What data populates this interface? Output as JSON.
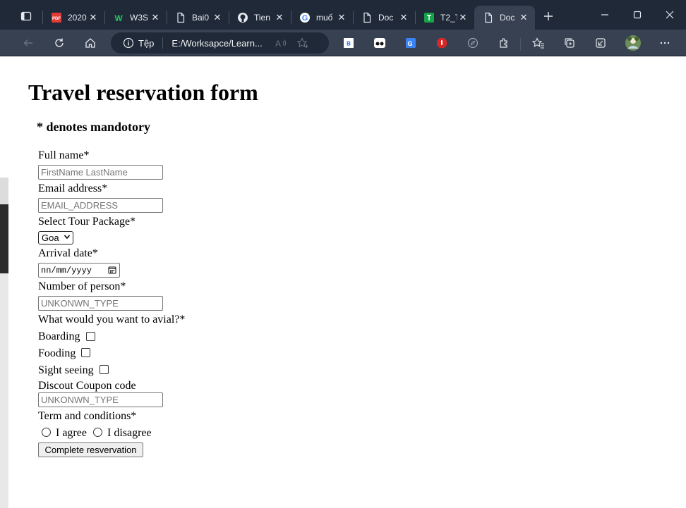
{
  "browser": {
    "tabs": [
      {
        "title": "2020",
        "icon": "pdf-icon"
      },
      {
        "title": "W3S",
        "icon": "w3schools-icon"
      },
      {
        "title": "Bai0",
        "icon": "document-icon"
      },
      {
        "title": "Tien",
        "icon": "github-icon"
      },
      {
        "title": "muố",
        "icon": "google-icon"
      },
      {
        "title": "Doc",
        "icon": "document-icon"
      },
      {
        "title": "T2_T",
        "icon": "sheets-icon"
      },
      {
        "title": "Doc",
        "icon": "document-icon",
        "active": true
      }
    ],
    "address": {
      "security_label": "Tệp",
      "url": "E:/Worksapce/Learn..."
    },
    "extensions": [
      "b-extension-icon",
      "goggles-extension-icon",
      "translate-extension-icon",
      "adblock-extension-icon",
      "compass-extension-icon"
    ],
    "colors": {
      "tabstrip": "#1f2937",
      "toolbar": "#374151"
    }
  },
  "form": {
    "title": "Travel reservation form",
    "note": "* denotes mandotory",
    "full_name": {
      "label": "Full name*",
      "placeholder": "FirstName LastName"
    },
    "email": {
      "label": "Email address*",
      "placeholder": "EMAIL_ADDRESS"
    },
    "package": {
      "label": "Select Tour Package*",
      "selected": "Goa"
    },
    "arrival": {
      "label": "Arrival date*",
      "value": "nn/mm/yyyy"
    },
    "persons": {
      "label": "Number of person*",
      "placeholder": "UNKONWN_TYPE"
    },
    "avail": {
      "label": "What would you want to avial?*",
      "options": [
        "Boarding",
        "Fooding",
        "Sight seeing"
      ]
    },
    "coupon": {
      "label": "Discout Coupon code",
      "placeholder": "UNKONWN_TYPE"
    },
    "terms": {
      "label": "Term and conditions*",
      "agree": "I agree",
      "disagree": "I disagree"
    },
    "submit_label": "Complete resvervation"
  }
}
